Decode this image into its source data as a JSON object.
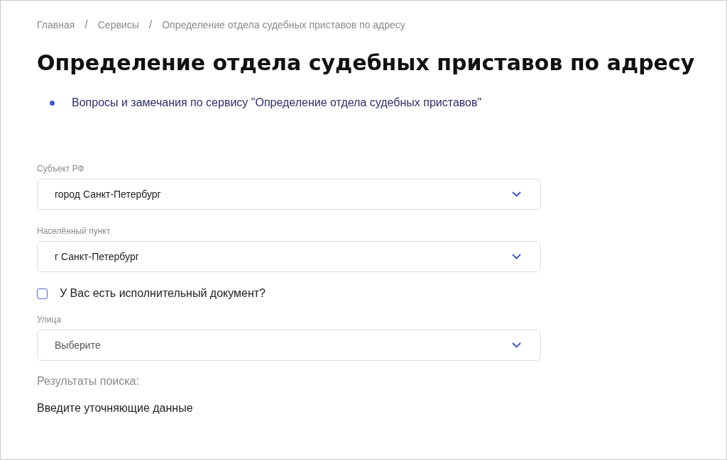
{
  "breadcrumbs": [
    {
      "label": "Главная"
    },
    {
      "label": "Сервисы"
    },
    {
      "label": "Определение отдела судебных приставов по адресу"
    }
  ],
  "separator": "/",
  "title": "Определение отдела судебных приставов по адресу",
  "links": [
    "Вопросы и замечания по сервису \"Определение отдела судебных приставов\""
  ],
  "form": [
    {
      "kind": "select",
      "label": "Субъект РФ",
      "value": "город Санкт-Петербург"
    },
    {
      "kind": "select",
      "label": "Населённый пункт",
      "value": "г Санкт-Петербург"
    },
    {
      "kind": "checkbox",
      "label": "У Вас есть исполнительный документ?",
      "checked": false
    },
    {
      "kind": "select",
      "label": "Улица",
      "placeholder": "Выберите"
    }
  ],
  "results": {
    "heading": "Результаты поиска:",
    "message": "Введите уточняющие данные"
  }
}
